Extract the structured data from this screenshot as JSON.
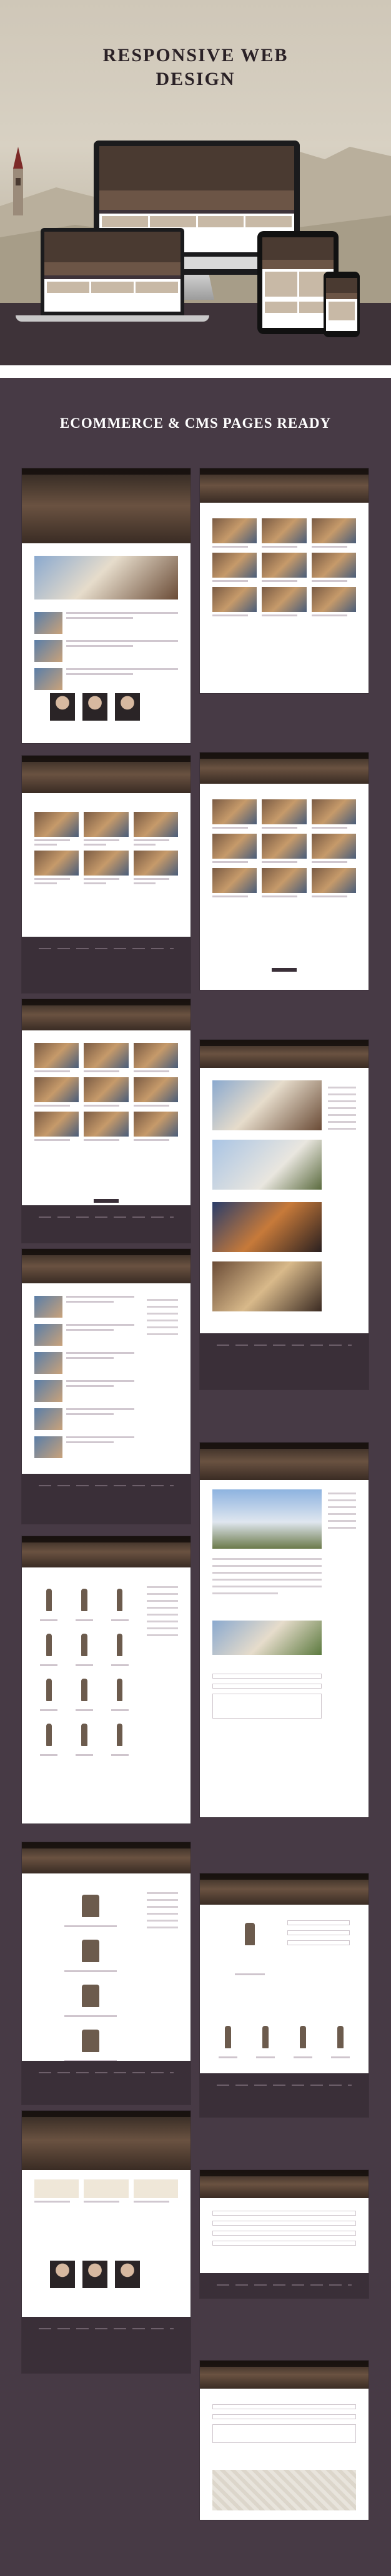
{
  "hero": {
    "title_line1": "RESPONSIVE WEB",
    "title_line2": "DESIGN"
  },
  "main": {
    "section_title": "ECOMMERCE & CMS PAGES READY"
  },
  "colors": {
    "hero_bg": "#d8d1c3",
    "main_bg": "#473a45",
    "footer_bg": "#3a2f38",
    "header_brown": "#6a5241"
  }
}
